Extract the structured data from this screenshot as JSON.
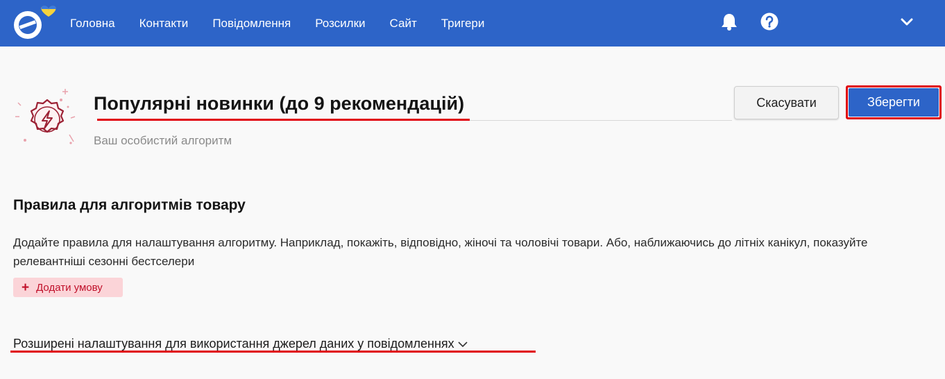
{
  "nav": {
    "items": [
      "Головна",
      "Контакти",
      "Повідомлення",
      "Розсилки",
      "Сайт",
      "Тригери"
    ],
    "accent_color": "#2d64c8"
  },
  "header": {
    "title": "Популярні новинки (до 9 рекомендацій)",
    "subtitle": "Ваш особистий алгоритм",
    "cancel_label": "Скасувати",
    "save_label": "Зберегти"
  },
  "rules": {
    "heading": "Правила для алгоритмів товару",
    "description": "Додайте правила для налаштування алгоритму. Наприклад, покажіть, відповідно, жіночі та чоловічі товари. Або, наближаючись до літніх канікул, показуйте релевантніші сезонні бестселери",
    "add_condition_label": "Додати умову"
  },
  "advanced": {
    "label": "Розширені налаштування для використання джерел даних у повідомленнях"
  },
  "highlight_color": "#e0000a"
}
